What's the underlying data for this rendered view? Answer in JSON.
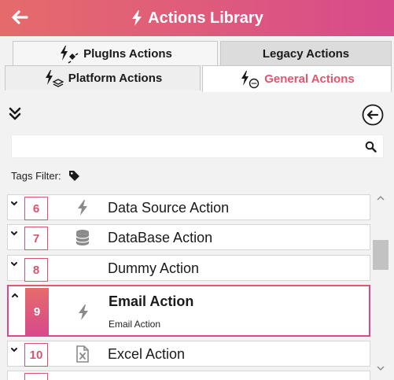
{
  "header": {
    "title": "Actions Library",
    "back_icon": "arrow-left-icon",
    "title_icon": "lightning-icon"
  },
  "tabs": {
    "plugins": "PlugIns Actions",
    "legacy": "Legacy Actions",
    "platform": "Platform Actions",
    "general": "General Actions",
    "active": "general"
  },
  "toolbar": {
    "collapse_icon": "double-chevron-down-icon",
    "back_icon": "circle-arrow-left-icon"
  },
  "search": {
    "value": "",
    "placeholder": "",
    "icon": "search-icon"
  },
  "tags_filter": {
    "label": "Tags Filter:",
    "icon": "tag-icon"
  },
  "actions": [
    {
      "number": "6",
      "name": "Data Source Action",
      "icon": "lightning-icon"
    },
    {
      "number": "7",
      "name": "DataBase Action",
      "icon": "database-icon"
    },
    {
      "number": "8",
      "name": "Dummy Action",
      "icon": ""
    },
    {
      "number": "9",
      "name": "Email Action",
      "description": "Email Action",
      "icon": "lightning-icon",
      "selected": true
    },
    {
      "number": "10",
      "name": "Excel Action",
      "icon": "excel-file-icon"
    }
  ],
  "colors": {
    "accent": "#e0566f",
    "header_start": "#e56b6b",
    "header_end": "#d84a8c"
  }
}
